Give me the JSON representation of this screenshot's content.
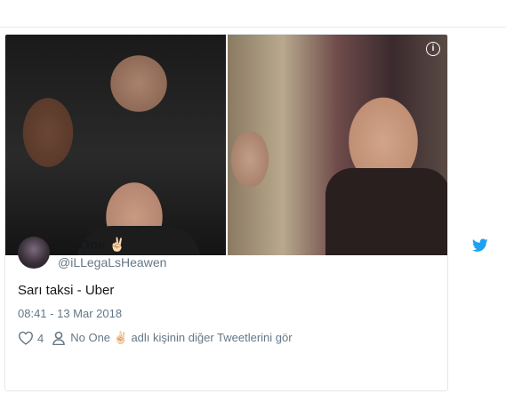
{
  "tweet": {
    "display_name": "No One ✌🏻",
    "handle": "@iLLegaLsHeawen",
    "text": "Sarı taksi - Uber",
    "timestamp": "08:41 - 13 Mar 2018",
    "likes": "4",
    "more_tweets": "No One ✌🏻 adlı kişinin diğer Tweetlerini gör"
  },
  "media": {
    "info_icon": "info-icon",
    "images": [
      "photo-left",
      "photo-right"
    ]
  },
  "icons": {
    "brand": "twitter-bird-icon",
    "like": "heart-icon",
    "profile": "person-icon"
  },
  "colors": {
    "brand": "#1da1f2",
    "text": "#14171a",
    "muted": "#657786",
    "border": "#e1e8ed"
  }
}
